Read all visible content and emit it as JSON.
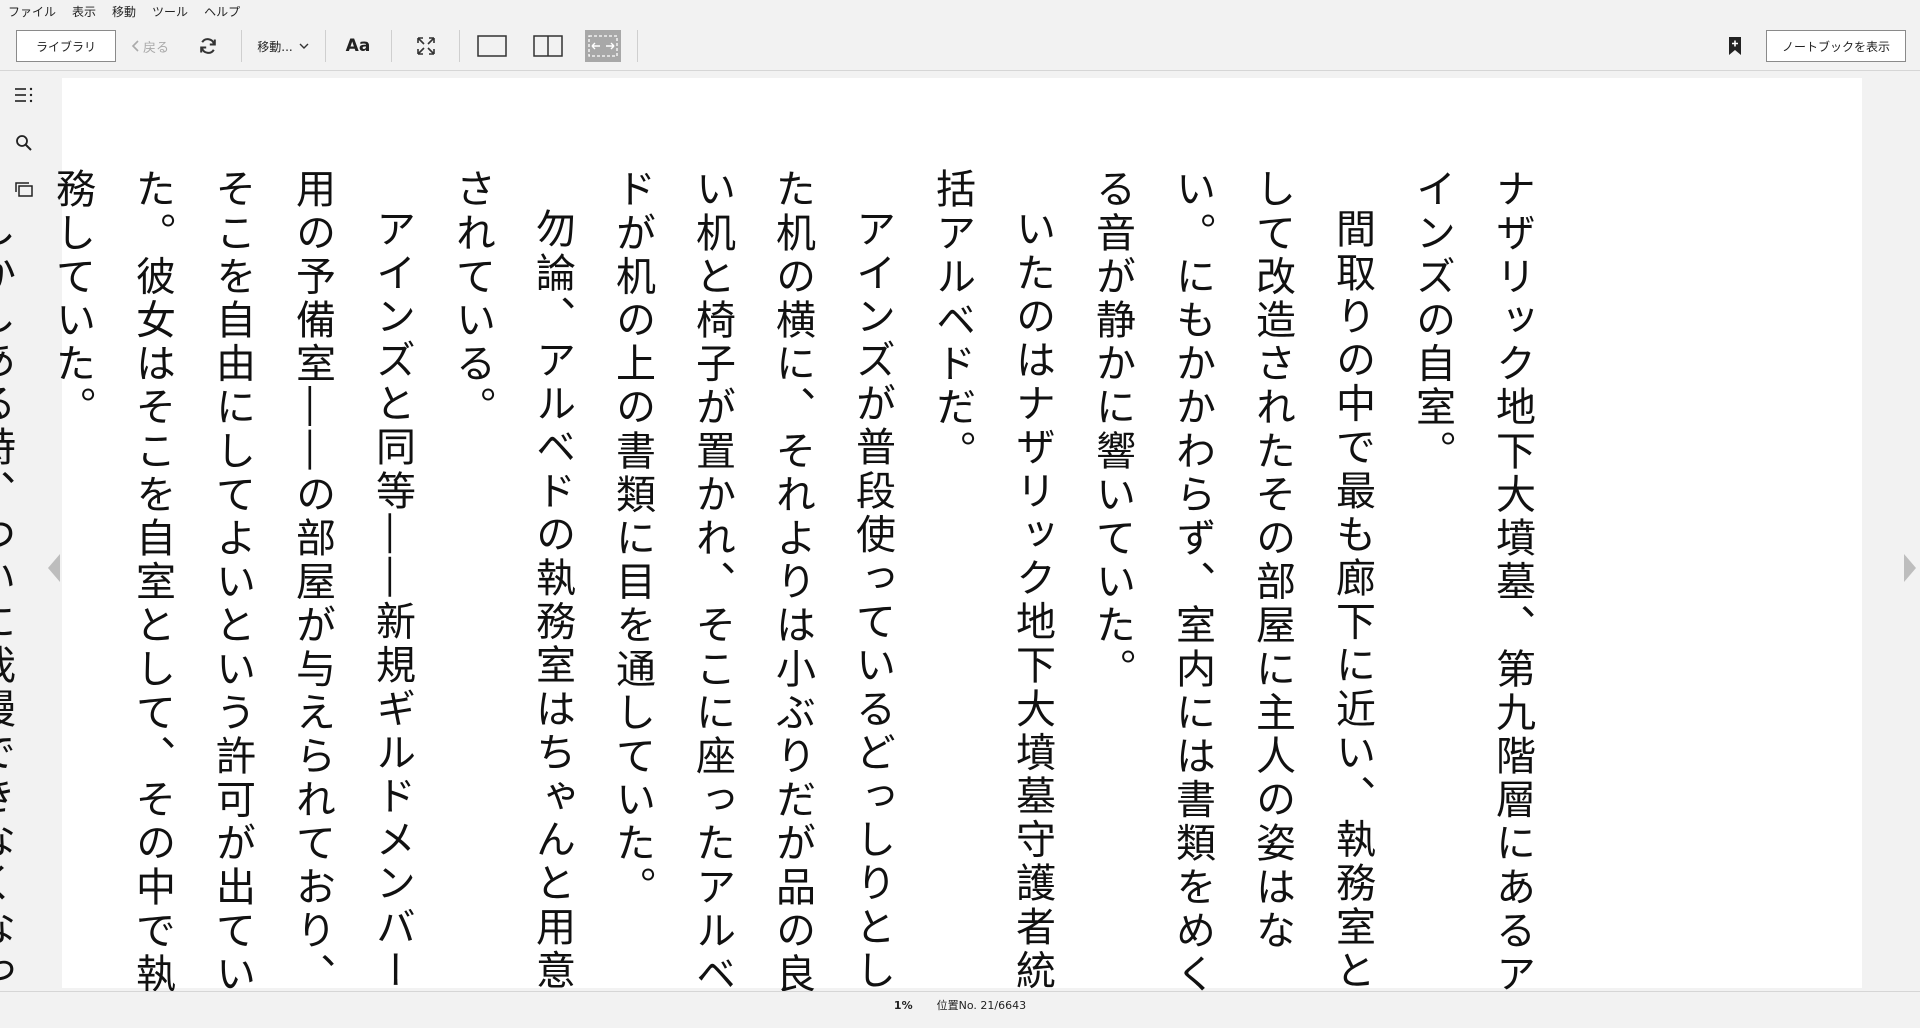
{
  "menubar": {
    "items": [
      "ファイル",
      "表示",
      "移動",
      "ツール",
      "ヘルプ"
    ]
  },
  "toolbar": {
    "library_label": "ライブラリ",
    "back_label": "戻る",
    "goto_label": "移動...",
    "font_label": "Aa",
    "notebook_label": "ノートブックを表示"
  },
  "book": {
    "paragraphs": [
      {
        "text": "ナザリック地下大墳墓、第九階層にあるアインズの自室。",
        "indent": false
      },
      {
        "text": "間取りの中で最も廊下に近い、執務室として改造されたその部屋に主人の姿はない。にもかかわらず、室内には書類をめくる音が静かに響いていた。",
        "indent": true
      },
      {
        "text": "いたのはナザリック地下大墳墓守護者統括アルベドだ。",
        "indent": true
      },
      {
        "text": "アインズが普段使っているどっしりとした机の横に、それよりは小ぶりだが品の良い机と椅子が置かれ、そこに座ったアルベドが机の上の書類に目を通していた。",
        "indent": true
      },
      {
        "text": "勿論、アルベドの執務室はちゃんと用意されている。",
        "indent": true
      },
      {
        "text": "アインズと同等――新規ギルドメンバー用の予備室――の部屋が与えられており、そこを自由にしてよいという許可が出ていた。彼女はそこを自室として、その中で執務していた。",
        "indent": true
      },
      {
        "text": "しかしある時、ついに我慢できなくなって自",
        "indent": true
      }
    ]
  },
  "status": {
    "percent": "1%",
    "location": "位置No. 21/6643"
  }
}
